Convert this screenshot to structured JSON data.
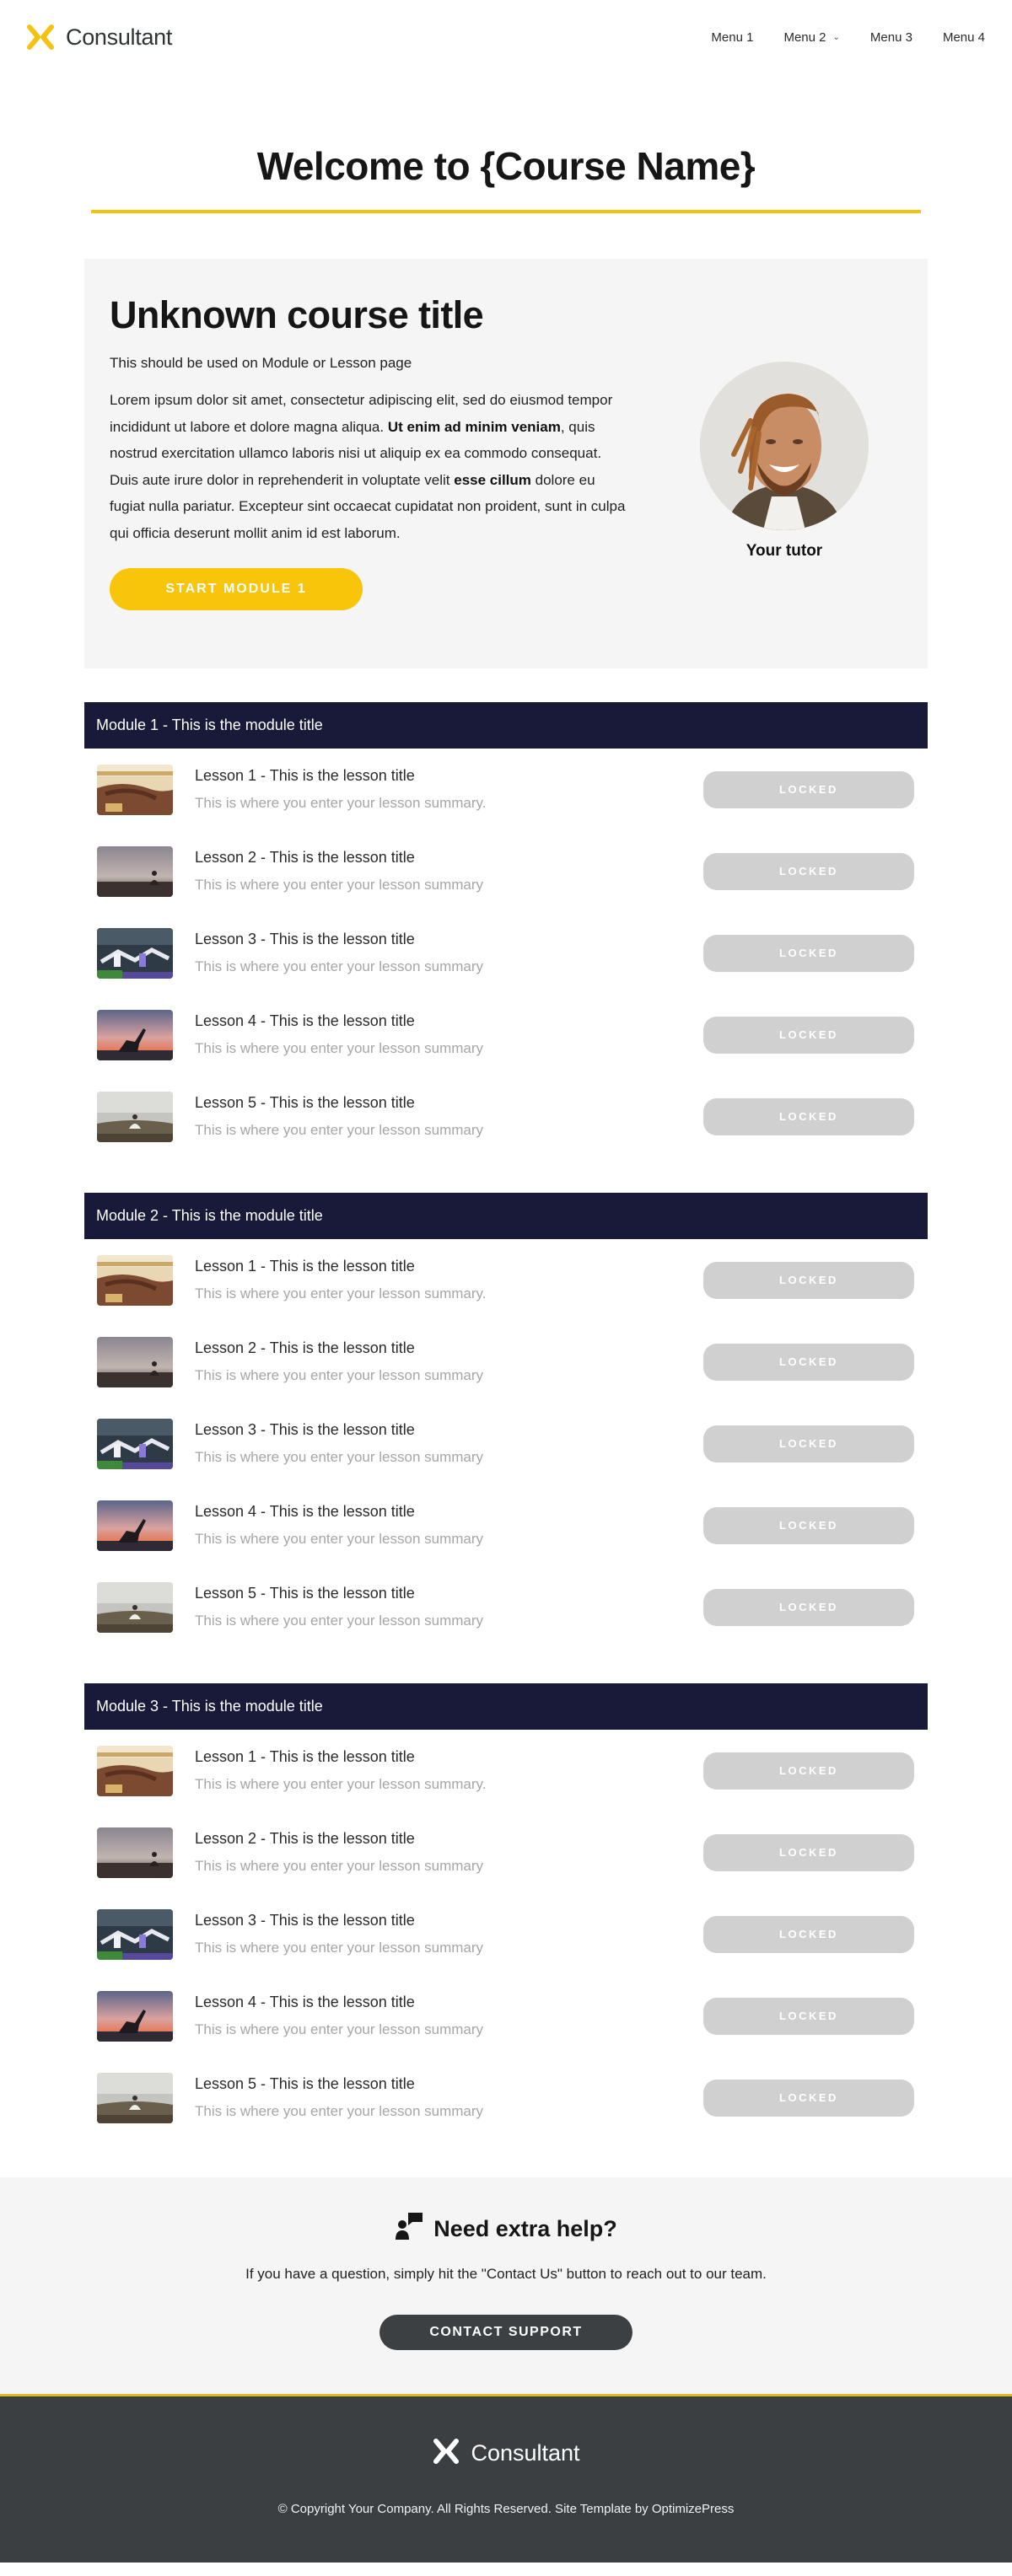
{
  "header": {
    "logo_text": "Consultant",
    "menu": [
      {
        "label": "Menu 1",
        "has_dropdown": false
      },
      {
        "label": "Menu 2",
        "has_dropdown": true
      },
      {
        "label": "Menu 3",
        "has_dropdown": false
      },
      {
        "label": "Menu 4",
        "has_dropdown": false
      }
    ]
  },
  "welcome": {
    "title": "Welcome to {Course Name}"
  },
  "intro": {
    "course_title": "Unknown course title",
    "subtitle": "This should be used on Module or Lesson page",
    "body_segments": [
      {
        "text": "Lorem ipsum dolor sit amet, consectetur adipiscing elit, sed do eiusmod tempor incididunt ut labore et dolore magna aliqua. ",
        "bold": false
      },
      {
        "text": "Ut enim ad minim veniam",
        "bold": true
      },
      {
        "text": ", quis nostrud exercitation ullamco laboris nisi ut aliquip ex ea commodo consequat. Duis aute irure dolor in reprehenderit in voluptate velit ",
        "bold": false
      },
      {
        "text": "esse cillum",
        "bold": true
      },
      {
        "text": " dolore eu fugiat nulla pariatur. Excepteur sint occaecat cupidatat non proident, sunt in culpa qui officia deserunt mollit anim id est laborum.",
        "bold": false
      }
    ],
    "start_button": "START MODULE 1",
    "tutor_label": "Your tutor"
  },
  "modules": [
    {
      "title": "Module 1 - This is the module title",
      "lessons": [
        {
          "title": "Lesson 1 - This is the lesson title",
          "summary": "This is where you enter your lesson summary.",
          "status": "LOCKED",
          "thumb": "hands-beach"
        },
        {
          "title": "Lesson 2 - This is the lesson title",
          "summary": "This is where you enter your lesson summary",
          "status": "LOCKED",
          "thumb": "meditation-dusk"
        },
        {
          "title": "Lesson 3 - This is the lesson title",
          "summary": "This is where you enter your lesson summary",
          "status": "LOCKED",
          "thumb": "yoga-class"
        },
        {
          "title": "Lesson 4 - This is the lesson title",
          "summary": "This is where you enter your lesson summary",
          "status": "LOCKED",
          "thumb": "yoga-sunset"
        },
        {
          "title": "Lesson 5 - This is the lesson title",
          "summary": "This is where you enter your lesson summary",
          "status": "LOCKED",
          "thumb": "meditation-hill"
        }
      ]
    },
    {
      "title": "Module 2 - This is the module title",
      "lessons": [
        {
          "title": "Lesson 1 - This is the lesson title",
          "summary": "This is where you enter your lesson summary.",
          "status": "LOCKED",
          "thumb": "hands-beach"
        },
        {
          "title": "Lesson 2 - This is the lesson title",
          "summary": "This is where you enter your lesson summary",
          "status": "LOCKED",
          "thumb": "meditation-dusk"
        },
        {
          "title": "Lesson 3 - This is the lesson title",
          "summary": "This is where you enter your lesson summary",
          "status": "LOCKED",
          "thumb": "yoga-class"
        },
        {
          "title": "Lesson 4 - This is the lesson title",
          "summary": "This is where you enter your lesson summary",
          "status": "LOCKED",
          "thumb": "yoga-sunset"
        },
        {
          "title": "Lesson 5 - This is the lesson title",
          "summary": "This is where you enter your lesson summary",
          "status": "LOCKED",
          "thumb": "meditation-hill"
        }
      ]
    },
    {
      "title": "Module 3 - This is the module title",
      "lessons": [
        {
          "title": "Lesson 1 - This is the lesson title",
          "summary": "This is where you enter your lesson summary.",
          "status": "LOCKED",
          "thumb": "hands-beach"
        },
        {
          "title": "Lesson 2 - This is the lesson title",
          "summary": "This is where you enter your lesson summary",
          "status": "LOCKED",
          "thumb": "meditation-dusk"
        },
        {
          "title": "Lesson 3 - This is the lesson title",
          "summary": "This is where you enter your lesson summary",
          "status": "LOCKED",
          "thumb": "yoga-class"
        },
        {
          "title": "Lesson 4 - This is the lesson title",
          "summary": "This is where you enter your lesson summary",
          "status": "LOCKED",
          "thumb": "yoga-sunset"
        },
        {
          "title": "Lesson 5 - This is the lesson title",
          "summary": "This is where you enter your lesson summary",
          "status": "LOCKED",
          "thumb": "meditation-hill"
        }
      ]
    }
  ],
  "help": {
    "icon": "support-chat-icon",
    "title": "Need extra help?",
    "text": "If you have a question, simply hit the \"Contact Us\" button to reach out to our team.",
    "button": "CONTACT SUPPORT"
  },
  "footer": {
    "logo_text": "Consultant",
    "copyright": "© Copyright Your Company.  All Rights Reserved. Site Template by OptimizePress"
  },
  "colors": {
    "accent_yellow": "#f8c50a",
    "module_header": "#191a39",
    "locked_button": "#d0d0d0",
    "contact_button": "#3c4043",
    "footer_bg": "#3b3f42",
    "panel_bg": "#f5f5f5"
  }
}
